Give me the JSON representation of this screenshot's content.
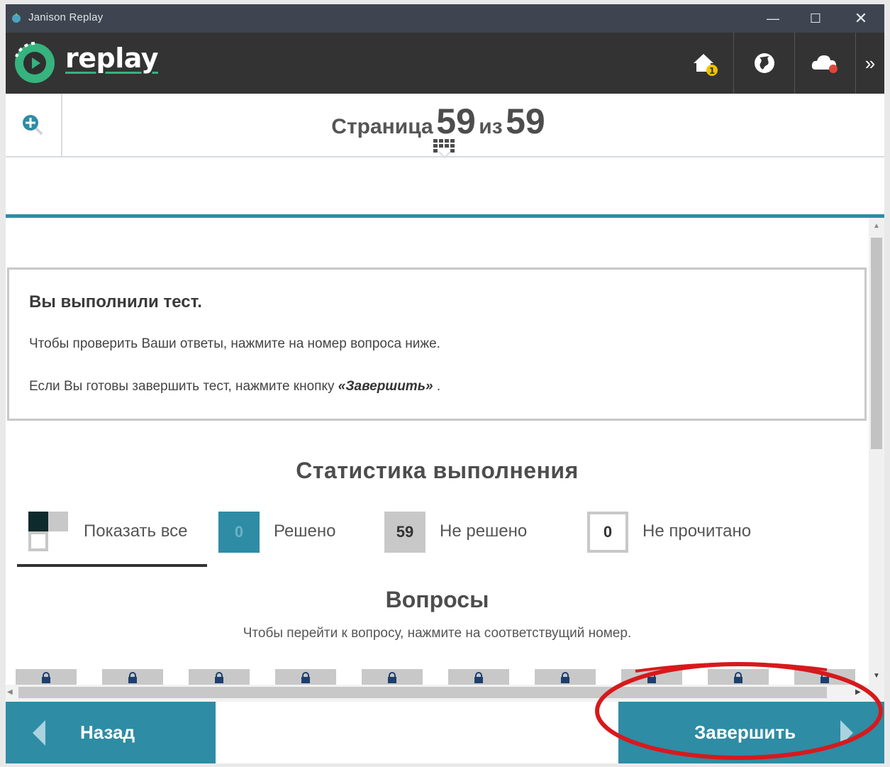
{
  "window": {
    "title": "Janison Replay",
    "minimize_glyph": "—",
    "maximize_glyph": "☐",
    "close_glyph": "✕"
  },
  "header": {
    "logo_text": "replay",
    "more_glyph": "»",
    "notification_badge": "1",
    "brand_color": "#2e8ca5"
  },
  "page_nav": {
    "word_page": "Страница",
    "current": "59",
    "word_of": "из",
    "total": "59"
  },
  "message": {
    "heading": "Вы выполнили тест.",
    "line1": "Чтобы проверить Ваши ответы, нажмите на номер вопроса ниже.",
    "line2_prefix": "Если Вы готовы завершить тест, нажмите кнопку ",
    "line2_button": "«Завершить»",
    "line2_suffix": " ."
  },
  "stats": {
    "title": "Статистика выполнения",
    "filters": {
      "all_label": "Показать все",
      "solved_count": "0",
      "solved_label": "Решено",
      "unsolved_count": "59",
      "unsolved_label": "Не решено",
      "unread_count": "0",
      "unread_label": "Не прочитано"
    }
  },
  "questions": {
    "title": "Вопросы",
    "hint": "Чтобы перейти к вопросу, нажмите на соответствущий номер."
  },
  "footer": {
    "back_label": "Назад",
    "finish_label": "Завершить"
  }
}
